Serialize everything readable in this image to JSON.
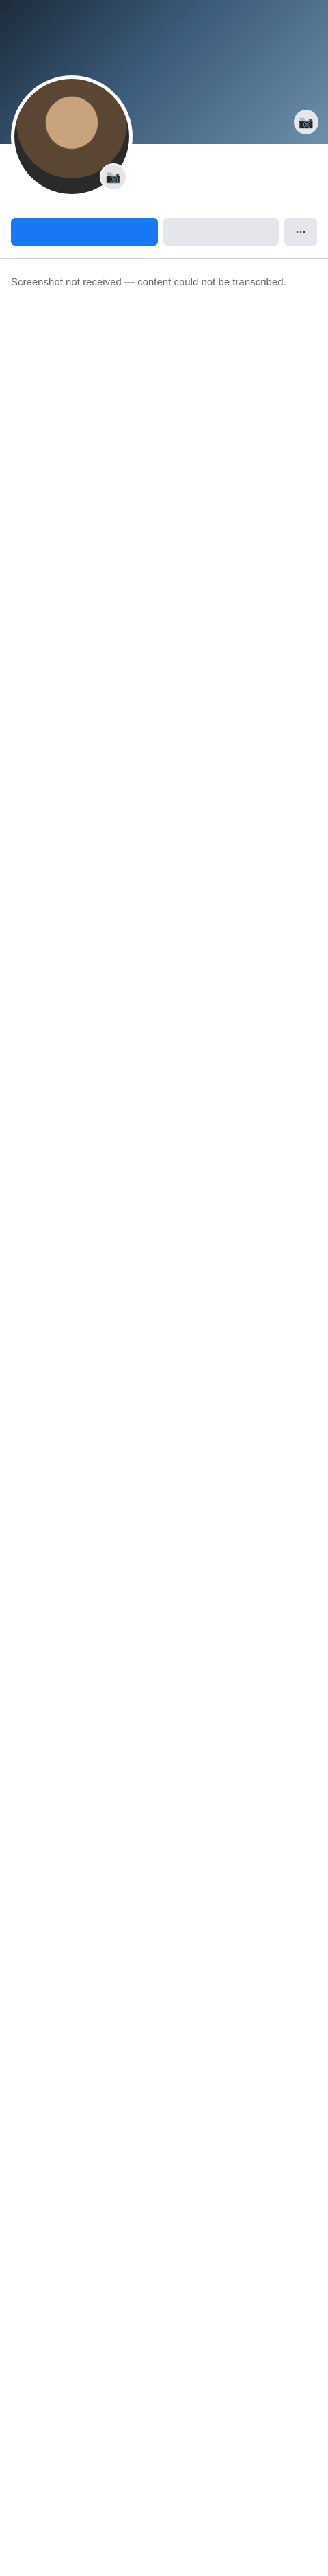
{
  "profile": {
    "name": "",
    "friends_count": "",
    "bio": ""
  },
  "actions": {
    "primary_label": "",
    "secondary_label": ""
  },
  "tabs": [],
  "notice": "Screenshot not received — content could not be transcribed."
}
